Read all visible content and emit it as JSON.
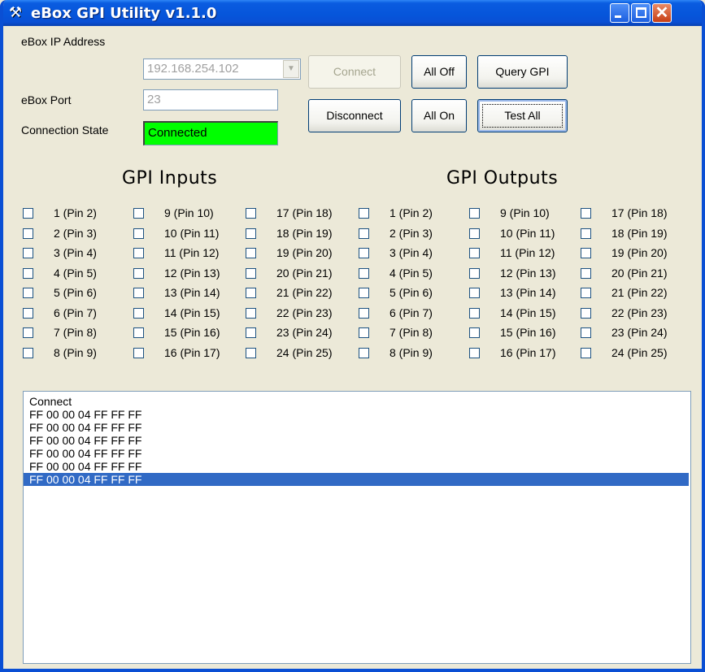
{
  "window": {
    "title": "eBox GPI Utility v1.1.0",
    "icon": "tools-icon"
  },
  "connection": {
    "ip_label": "eBox IP Address",
    "ip_value": "192.168.254.102",
    "port_label": "eBox Port",
    "port_value": "23",
    "state_label": "Connection State",
    "state_value": "Connected",
    "state_color": "#00ff00"
  },
  "buttons": {
    "connect": "Connect",
    "disconnect": "Disconnect",
    "all_off": "All Off",
    "all_on": "All On",
    "query_gpi": "Query GPI",
    "test_all": "Test All"
  },
  "inputs": {
    "heading": "GPI Inputs",
    "columns": [
      [
        "1 (Pin 2)",
        "2 (Pin 3)",
        "3 (Pin 4)",
        "4 (Pin 5)",
        "5 (Pin 6)",
        "6 (Pin 7)",
        "7 (Pin 8)",
        "8 (Pin 9)"
      ],
      [
        "9 (Pin 10)",
        "10 (Pin 11)",
        "11 (Pin 12)",
        "12 (Pin 13)",
        "13 (Pin 14)",
        "14 (Pin 15)",
        "15 (Pin 16)",
        "16 (Pin 17)"
      ],
      [
        "17 (Pin 18)",
        "18 (Pin 19)",
        "19 (Pin 20)",
        "20 (Pin 21)",
        "21 (Pin 22)",
        "22 (Pin 23)",
        "23 (Pin 24)",
        "24 (Pin 25)"
      ]
    ]
  },
  "outputs": {
    "heading": "GPI Outputs",
    "columns": [
      [
        "1 (Pin 2)",
        "2 (Pin 3)",
        "3 (Pin 4)",
        "4 (Pin 5)",
        "5 (Pin 6)",
        "6 (Pin 7)",
        "7 (Pin 8)",
        "8 (Pin 9)"
      ],
      [
        "9 (Pin 10)",
        "10 (Pin 11)",
        "11 (Pin 12)",
        "12 (Pin 13)",
        "13 (Pin 14)",
        "14 (Pin 15)",
        "15 (Pin 16)",
        "16 (Pin 17)"
      ],
      [
        "17 (Pin 18)",
        "18 (Pin 19)",
        "19 (Pin 20)",
        "20 (Pin 21)",
        "21 (Pin 22)",
        "22 (Pin 23)",
        "23 (Pin 24)",
        "24 (Pin 25)"
      ]
    ]
  },
  "log": {
    "lines": [
      "Connect",
      "FF 00 00 04 FF FF FF",
      "FF 00 00 04 FF FF FF",
      "FF 00 00 04 FF FF FF",
      "FF 00 00 04 FF FF FF",
      "FF 00 00 04 FF FF FF",
      "FF 00 00 04 FF FF FF"
    ],
    "selected_index": 6,
    "selection_color": "#316ac5"
  }
}
